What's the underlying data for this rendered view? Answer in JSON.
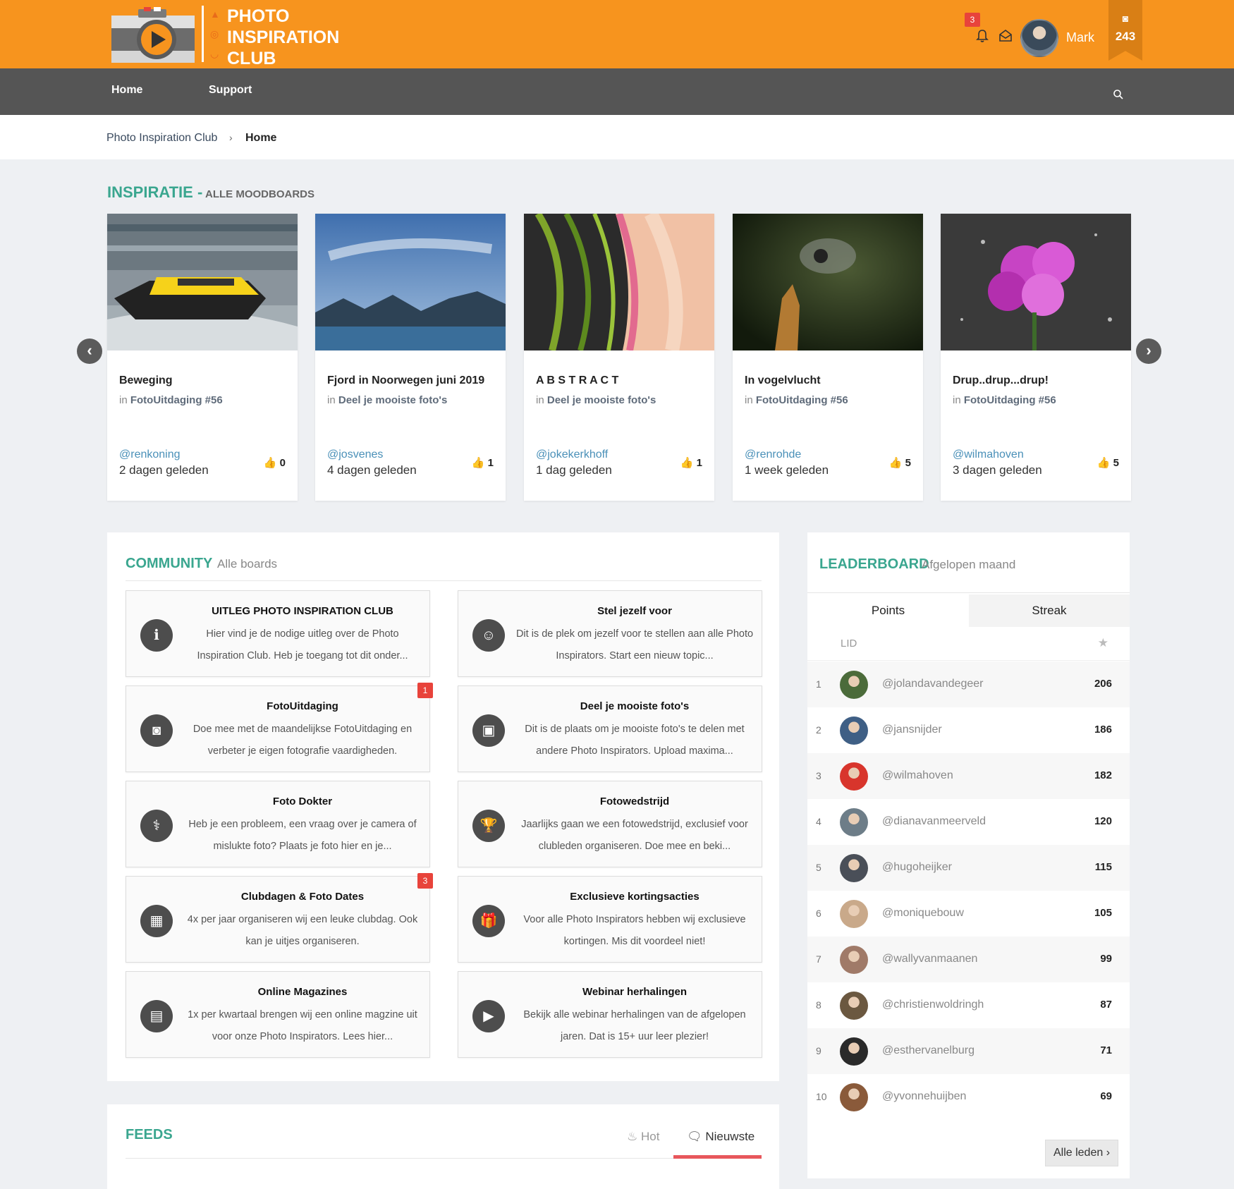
{
  "header": {
    "logo_lines": [
      "PHOTO",
      "INSPIRATION",
      "CLUB"
    ],
    "notification_count": "3",
    "user_name": "Mark",
    "points": "243",
    "accent_color": "#f7941e"
  },
  "nav": {
    "items": [
      "Home",
      "Support"
    ]
  },
  "breadcrumb": {
    "root": "Photo Inspiration Club",
    "separator": "›",
    "current": "Home"
  },
  "inspiratie": {
    "title": "INSPIRATIE -",
    "subtitle": "ALLE MOODBOARDS",
    "in_label": "in",
    "cards": [
      {
        "title": "Beweging",
        "board": "FotoUitdaging #56",
        "user": "@renkoning",
        "time": "2 dagen geleden",
        "likes": "0"
      },
      {
        "title": "Fjord in Noorwegen juni 2019",
        "board": "Deel je mooiste foto's",
        "user": "@josvenes",
        "time": "4 dagen geleden",
        "likes": "1"
      },
      {
        "title": "A B S T R A C T",
        "board": "Deel je mooiste foto's",
        "user": "@jokekerkhoff",
        "time": "1 dag geleden",
        "likes": "1"
      },
      {
        "title": "In vogelvlucht",
        "board": "FotoUitdaging #56",
        "user": "@renrohde",
        "time": "1 week geleden",
        "likes": "5"
      },
      {
        "title": "Drup..drup...drup!",
        "board": "FotoUitdaging #56",
        "user": "@wilmahoven",
        "time": "3 dagen geleden",
        "likes": "5"
      }
    ]
  },
  "community": {
    "title": "COMMUNITY",
    "subtitle": "Alle boards",
    "boards": [
      {
        "icon": "info-icon",
        "title": "UITLEG PHOTO INSPIRATION CLUB",
        "desc": "Hier vind je de nodige uitleg over de Photo Inspiration Club. Heb je toegang tot dit onder...",
        "badge": ""
      },
      {
        "icon": "person-icon",
        "title": "Stel jezelf voor",
        "desc": "Dit is de plek om jezelf voor te stellen aan alle Photo Inspirators. Start een nieuw topic...",
        "badge": ""
      },
      {
        "icon": "camera-icon",
        "title": "FotoUitdaging",
        "desc": "Doe mee met de maandelijkse FotoUitdaging en verbeter je eigen fotografie vaardigheden.",
        "badge": "1"
      },
      {
        "icon": "image-icon",
        "title": "Deel je mooiste foto's",
        "desc": "Dit is de plaats om je mooiste foto's te delen met andere Photo Inspirators. Upload maxima...",
        "badge": ""
      },
      {
        "icon": "stethoscope-icon",
        "title": "Foto Dokter",
        "desc": "Heb je een probleem, een vraag over je camera of mislukte foto? Plaats je foto hier en je...",
        "badge": ""
      },
      {
        "icon": "trophy-icon",
        "title": "Fotowedstrijd",
        "desc": "Jaarlijks gaan we een fotowedstrijd, exclusief voor clubleden organiseren. Doe mee en beki...",
        "badge": ""
      },
      {
        "icon": "calendar-icon",
        "title": "Clubdagen & Foto Dates",
        "desc": "4x per jaar organiseren wij een leuke clubdag. Ook kan je uitjes organiseren.",
        "badge": "3"
      },
      {
        "icon": "gift-icon",
        "title": "Exclusieve kortingsacties",
        "desc": "Voor alle Photo Inspirators hebben wij exclusieve kortingen. Mis dit voordeel niet!",
        "badge": ""
      },
      {
        "icon": "book-icon",
        "title": "Online Magazines",
        "desc": "1x per kwartaal brengen wij een online magzine uit voor onze Photo Inspirators. Lees hier...",
        "badge": ""
      },
      {
        "icon": "play-icon",
        "title": "Webinar herhalingen",
        "desc": "Bekijk alle webinar herhalingen van de afgelopen jaren. Dat is 15+ uur leer plezier!",
        "badge": ""
      }
    ]
  },
  "leaderboard": {
    "title": "LEADERBOARD",
    "subtitle": "Afgelopen maand",
    "tabs": [
      "Points",
      "Streak"
    ],
    "column_member": "LID",
    "rows": [
      {
        "rank": "1",
        "user": "@jolandavandegeer",
        "points": "206",
        "color": "#4b6b3a"
      },
      {
        "rank": "2",
        "user": "@jansnijder",
        "points": "186",
        "color": "#3f5f85"
      },
      {
        "rank": "3",
        "user": "@wilmahoven",
        "points": "182",
        "color": "#d8352c"
      },
      {
        "rank": "4",
        "user": "@dianavanmeerveld",
        "points": "120",
        "color": "#6d7d88"
      },
      {
        "rank": "5",
        "user": "@hugoheijker",
        "points": "115",
        "color": "#4a4f58"
      },
      {
        "rank": "6",
        "user": "@moniquebouw",
        "points": "105",
        "color": "#c9a98a"
      },
      {
        "rank": "7",
        "user": "@wallyvanmaanen",
        "points": "99",
        "color": "#a07a68"
      },
      {
        "rank": "8",
        "user": "@christienwoldringh",
        "points": "87",
        "color": "#6b5840"
      },
      {
        "rank": "9",
        "user": "@esthervanelburg",
        "points": "71",
        "color": "#2a2a2a"
      },
      {
        "rank": "10",
        "user": "@yvonnehuijben",
        "points": "69",
        "color": "#8a5a3a"
      }
    ],
    "all_members_label": "Alle leden ›"
  },
  "feeds": {
    "title": "FEEDS",
    "tabs": [
      "Hot",
      "Nieuwste"
    ],
    "active_tab": "Nieuwste"
  }
}
